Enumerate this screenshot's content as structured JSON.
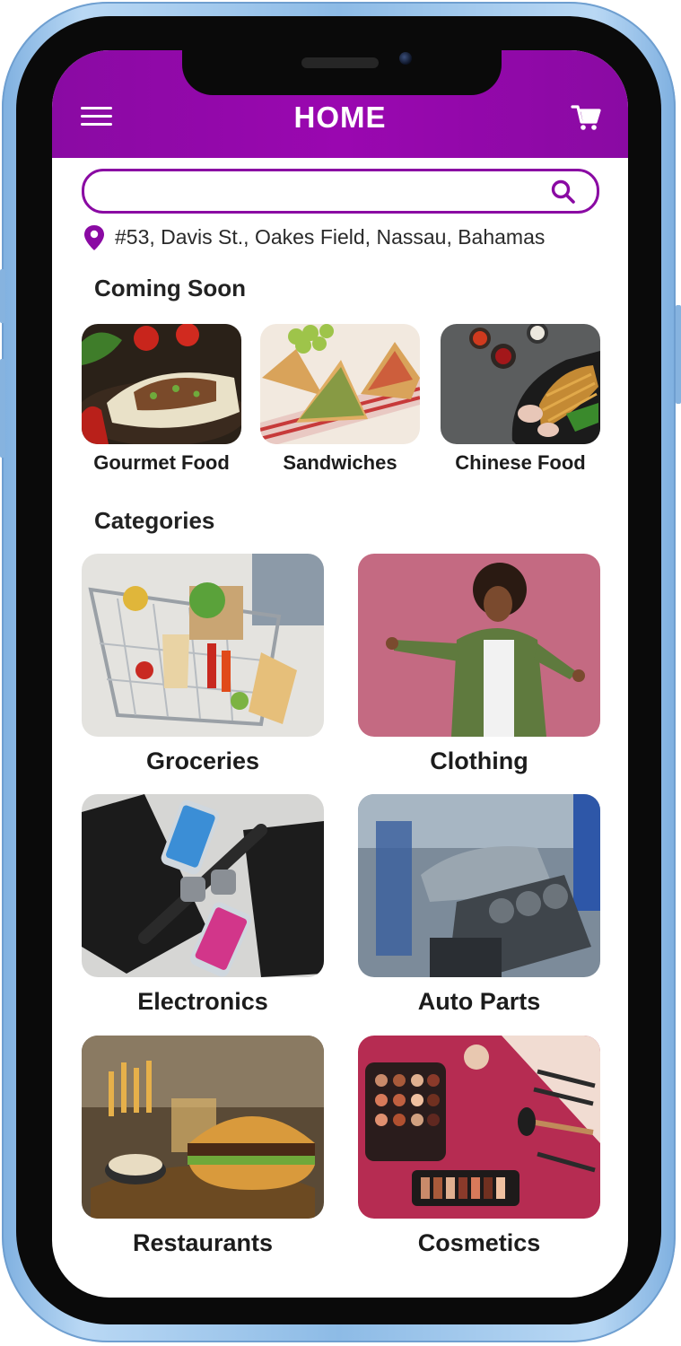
{
  "header": {
    "title": "HOME",
    "background_color": "#9a07b0"
  },
  "search": {
    "placeholder": "",
    "value": ""
  },
  "location": {
    "address": "#53, Davis St., Oakes Field, Nassau, Bahamas"
  },
  "coming_soon": {
    "title": "Coming Soon",
    "items": [
      {
        "label": "Gourmet Food"
      },
      {
        "label": "Sandwiches"
      },
      {
        "label": "Chinese Food"
      }
    ]
  },
  "categories": {
    "title": "Categories",
    "items": [
      {
        "label": "Groceries"
      },
      {
        "label": "Clothing"
      },
      {
        "label": "Electronics"
      },
      {
        "label": "Auto Parts"
      },
      {
        "label": "Restaurants"
      },
      {
        "label": "Cosmetics"
      }
    ]
  },
  "icons": {
    "menu": "hamburger-menu-icon",
    "cart": "shopping-cart-icon",
    "search": "search-icon",
    "location": "location-pin-icon"
  },
  "colors": {
    "accent": "#8a0aa3",
    "device_frame": "#9cc6ec"
  }
}
